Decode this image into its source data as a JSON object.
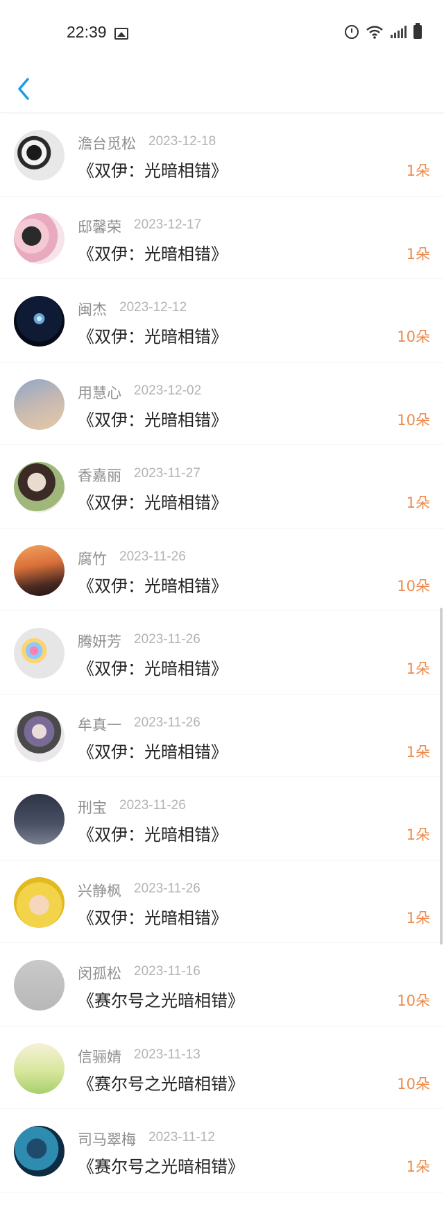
{
  "status_bar": {
    "time": "22:39"
  },
  "colors": {
    "accent": "#1e9be8",
    "count": "#ec8a4b",
    "name": "#8e8e8e",
    "date": "#b3b3b3"
  },
  "records": [
    {
      "name": "澹台觅松",
      "date": "2023-12-18",
      "title": "《双伊：光暗相错》",
      "count": "1朵"
    },
    {
      "name": "邸馨荣",
      "date": "2023-12-17",
      "title": "《双伊：光暗相错》",
      "count": "1朵"
    },
    {
      "name": "闽杰",
      "date": "2023-12-12",
      "title": "《双伊：光暗相错》",
      "count": "10朵"
    },
    {
      "name": "用慧心",
      "date": "2023-12-02",
      "title": "《双伊：光暗相错》",
      "count": "10朵"
    },
    {
      "name": "香嘉丽",
      "date": "2023-11-27",
      "title": "《双伊：光暗相错》",
      "count": "1朵"
    },
    {
      "name": "腐竹",
      "date": "2023-11-26",
      "title": "《双伊：光暗相错》",
      "count": "10朵"
    },
    {
      "name": "腾妍芳",
      "date": "2023-11-26",
      "title": "《双伊：光暗相错》",
      "count": "1朵"
    },
    {
      "name": "牟真一",
      "date": "2023-11-26",
      "title": "《双伊：光暗相错》",
      "count": "1朵"
    },
    {
      "name": "刑宝",
      "date": "2023-11-26",
      "title": "《双伊：光暗相错》",
      "count": "1朵"
    },
    {
      "name": "兴静枫",
      "date": "2023-11-26",
      "title": "《双伊：光暗相错》",
      "count": "1朵"
    },
    {
      "name": "闵孤松",
      "date": "2023-11-16",
      "title": "《赛尔号之光暗相错》",
      "count": "10朵"
    },
    {
      "name": "信骊婧",
      "date": "2023-11-13",
      "title": "《赛尔号之光暗相错》",
      "count": "10朵"
    },
    {
      "name": "司马翠梅",
      "date": "2023-11-12",
      "title": "《赛尔号之光暗相错》",
      "count": "1朵"
    }
  ]
}
